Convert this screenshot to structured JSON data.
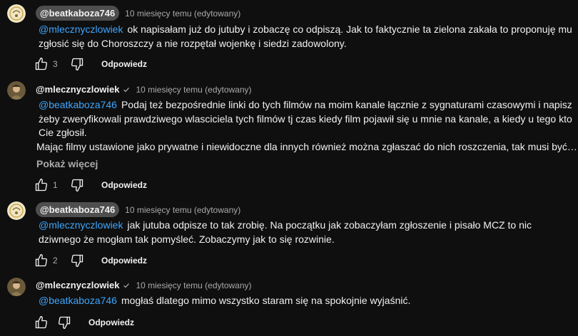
{
  "comments": [
    {
      "author": "@beatkaboza746",
      "time": "10 miesięcy temu (edytowany)",
      "mention": "@mlecznyczlowiek",
      "lines": [
        "ok napisałam już do jutuby i zobaczę co odpiszą. Jak to faktycznie ta zielona zakała to proponuję mu",
        "zgłosić się do Choroszczy a nie rozpętał wojenkę i siedzi zadowolony."
      ],
      "likes": "3",
      "reply_label": "Odpowiedz"
    },
    {
      "author": "@mlecznyczlowiek",
      "time": "10 miesięcy temu (edytowany)",
      "mention": "@beatkaboza746",
      "lines": [
        "Podaj też bezpośrednie linki do tych filmów na moim kanale łącznie z sygnaturami czasowymi i napisz",
        "żeby zweryfikowali prawdziwego wlasciciela tych filmów tj czas kiedy film pojawił się u mnie na kanale, a kiedy u tego kto",
        "Cie zgłosił.",
        "Mając filmy ustawione jako prywatne i niewidoczne dla innych również można zgłaszać do nich roszczenia, tak musi być…"
      ],
      "show_more": "Pokaż więcej",
      "likes": "1",
      "reply_label": "Odpowiedz"
    },
    {
      "author": "@beatkaboza746",
      "time": "10 miesięcy temu (edytowany)",
      "mention": "@mlecznyczlowiek",
      "lines": [
        "jak jutuba odpisze to tak zrobię. Na początku jak zobaczyłam zgłoszenie i pisało MCZ to nic",
        "dziwnego że mogłam tak pomyśleć. Zobaczymy jak to się rozwinie."
      ],
      "likes": "2",
      "reply_label": "Odpowiedz"
    },
    {
      "author": "@mlecznyczlowiek",
      "time": "10 miesięcy temu (edytowany)",
      "mention": "@beatkaboza746",
      "lines": [
        "mogłaś dlatego mimo wszystko staram się na spokojnie wyjaśnić."
      ],
      "likes": "",
      "reply_label": "Odpowiedz"
    }
  ]
}
